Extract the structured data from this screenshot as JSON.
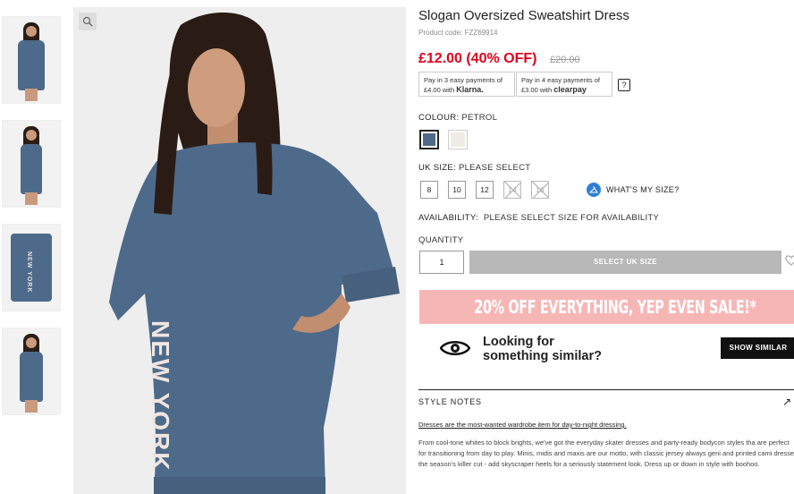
{
  "product": {
    "title": "Slogan Oversized Sweatshirt Dress",
    "code": "Product code: FZZ69914",
    "price": "£12.00 (40% OFF)",
    "was_price": "£20.00"
  },
  "payments": {
    "klarna_line1": "Pay in 3 easy payments of",
    "klarna_amount": "£4.00 with",
    "klarna_brand": "Klarna.",
    "clearpay_line1": "Pay in 4 easy payments of",
    "clearpay_amount": "£3.00 with",
    "clearpay_brand": "clearpay",
    "help": "?"
  },
  "colour": {
    "label": "COLOUR:",
    "value": "PETROL",
    "swatches": [
      "#4e6a8a",
      "#eeece4"
    ]
  },
  "size": {
    "label": "UK SIZE:",
    "value": "PLEASE SELECT",
    "options": [
      "8",
      "10",
      "12",
      "14",
      "16"
    ],
    "whats_my_size": "WHAT'S MY SIZE?"
  },
  "availability": {
    "label": "AVAILABILITY:",
    "value": "PLEASE SELECT SIZE FOR AVAILABILITY"
  },
  "quantity": {
    "label": "QUANTITY",
    "value": "1"
  },
  "add_button": "SELECT UK SIZE",
  "promo": "20% OFF EVERYTHING, YEP EVEN SALE!*",
  "similar": {
    "line1": "Looking for",
    "line2": "something similar?",
    "button": "SHOW SIMILAR"
  },
  "notes": {
    "heading": "STYLE NOTES",
    "link": "Dresses are the most-wanted wardrobe item for day-to-night dressing.",
    "body": "From cool-tone whites to block brights, we've got the everyday skater dresses and party-ready bodycon styles tha are perfect for transitioning from day to play. Minis, midis and maxis are our motto, with classic jersey always geni and printed cami dresses the season's killer cut - add skyscraper heels for a seriously statement look. Dress up or down in style with boohoo."
  },
  "image": {
    "slogan": "NEW YORK",
    "dress_color": "#4e6a8a"
  }
}
